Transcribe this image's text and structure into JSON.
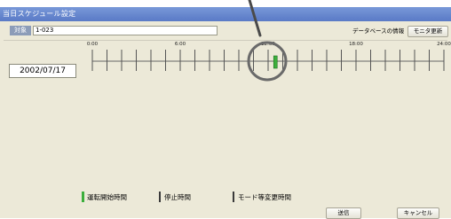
{
  "window": {
    "title": "当日スケジュール設定"
  },
  "target": {
    "label": "対象",
    "value": "1-023"
  },
  "buttons": {
    "database_info": "データベースの情報",
    "monitor_update": "モニタ更新",
    "send": "送信",
    "cancel": "キャンセル"
  },
  "date": "2002/07/17",
  "timeline": {
    "hour_labels": [
      "0:00",
      "6:00",
      "12:00",
      "18:00",
      "24:00"
    ],
    "hours_total": 24,
    "events": [
      {
        "type": "start",
        "time_hours": 12.5,
        "color": "#3cae3c"
      }
    ]
  },
  "legend": {
    "start": "運転開始時間",
    "stop": "停止時間",
    "mode_change": "モード等変更時間"
  },
  "colors": {
    "titlebar": "#5a7ac6",
    "start_marker": "#3cae3c",
    "annotation_circle": "#6a6a6a"
  }
}
